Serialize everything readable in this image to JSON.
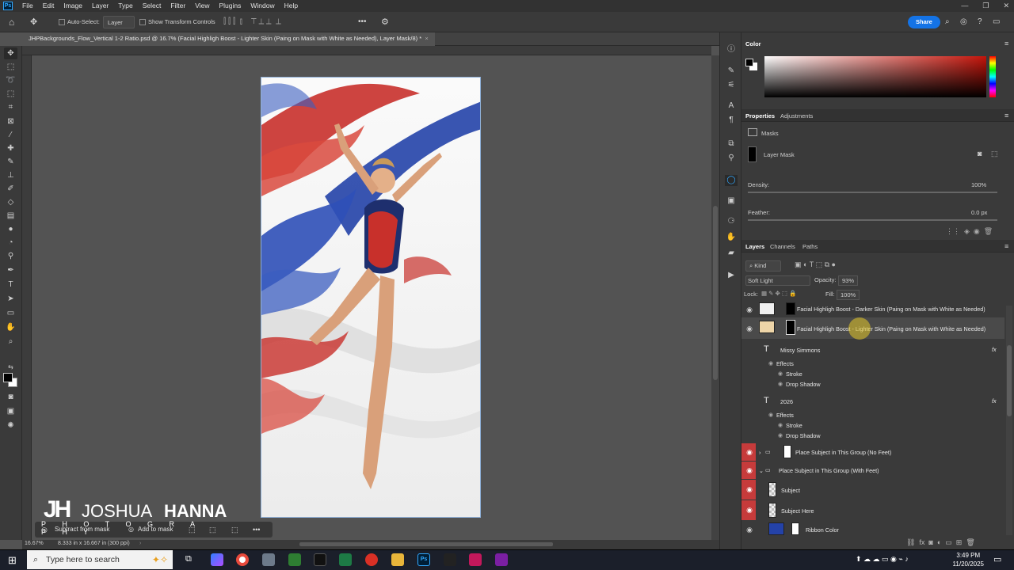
{
  "menu": {
    "app_badge": "Ps",
    "items": [
      "File",
      "Edit",
      "Image",
      "Layer",
      "Type",
      "Select",
      "Filter",
      "View",
      "Plugins",
      "Window",
      "Help"
    ]
  },
  "options": {
    "auto_select": "Auto-Select:",
    "layer_dropdown": "Layer",
    "transform_controls": "Show Transform Controls",
    "more": "•••",
    "share": "Share"
  },
  "document": {
    "tab_title": "JHPBackgrounds_Flow_Vertical 1-2 Ratio.psd @ 16.7% (Facial Highligh Boost - Lighter Skin (Paing on Mask with White as Needed), Layer Mask/8) *",
    "close": "×"
  },
  "status": {
    "zoom": "16.67%",
    "doc_info": "8.333 in x 16.667 in (300 ppi)"
  },
  "mask_bar": {
    "subtract": "Subtract from mask",
    "add": "Add to mask"
  },
  "watermark": {
    "logo": "JH",
    "name_part1": "JOSHUA",
    "name_part2": "HANNA",
    "sub": "P H O T O G R A P H Y"
  },
  "color_panel": {
    "title": "Color"
  },
  "properties": {
    "tab_properties": "Properties",
    "tab_adjustments": "Adjustments",
    "masks_label": "Masks",
    "layer_mask_label": "Layer Mask",
    "density_label": "Density:",
    "density_value": "100%",
    "feather_label": "Feather:",
    "feather_value": "0.0 px"
  },
  "layers_panel": {
    "tab_layers": "Layers",
    "tab_channels": "Channels",
    "tab_paths": "Paths",
    "kind": "Kind",
    "blend_mode": "Soft Light",
    "opacity_label": "Opacity:",
    "opacity_value": "93%",
    "lock_label": "Lock:",
    "fill_label": "Fill:",
    "fill_value": "100%",
    "layers": [
      {
        "name": "Facial Highligh Boost - Darker Skin (Paing on Mask with White as Needed)"
      },
      {
        "name": "Facial Highligh Boost - Lighter Skin (Paing on Mask with White as Needed)"
      },
      {
        "name": "Missy Simmons",
        "fx": "fx"
      },
      {
        "name": "Effects"
      },
      {
        "name": "Stroke"
      },
      {
        "name": "Drop Shadow"
      },
      {
        "name": "2026",
        "fx": "fx"
      },
      {
        "name": "Effects"
      },
      {
        "name": "Stroke"
      },
      {
        "name": "Drop Shadow"
      },
      {
        "name": "Place Subject in This Group (No Feet)"
      },
      {
        "name": "Place Subject in This Group (With Feet)"
      },
      {
        "name": "Subject"
      },
      {
        "name": "Subject Here"
      },
      {
        "name": "Ribbon Color"
      }
    ]
  },
  "taskbar": {
    "search_placeholder": "Type here to search",
    "time": "3:49 PM",
    "date": "11/20/2025"
  },
  "colors": {
    "accent": "#1473e6",
    "visibility_red": "#c63b3b",
    "ribbon_blue": "#2442a8",
    "ribbon_red": "#c8302b"
  }
}
